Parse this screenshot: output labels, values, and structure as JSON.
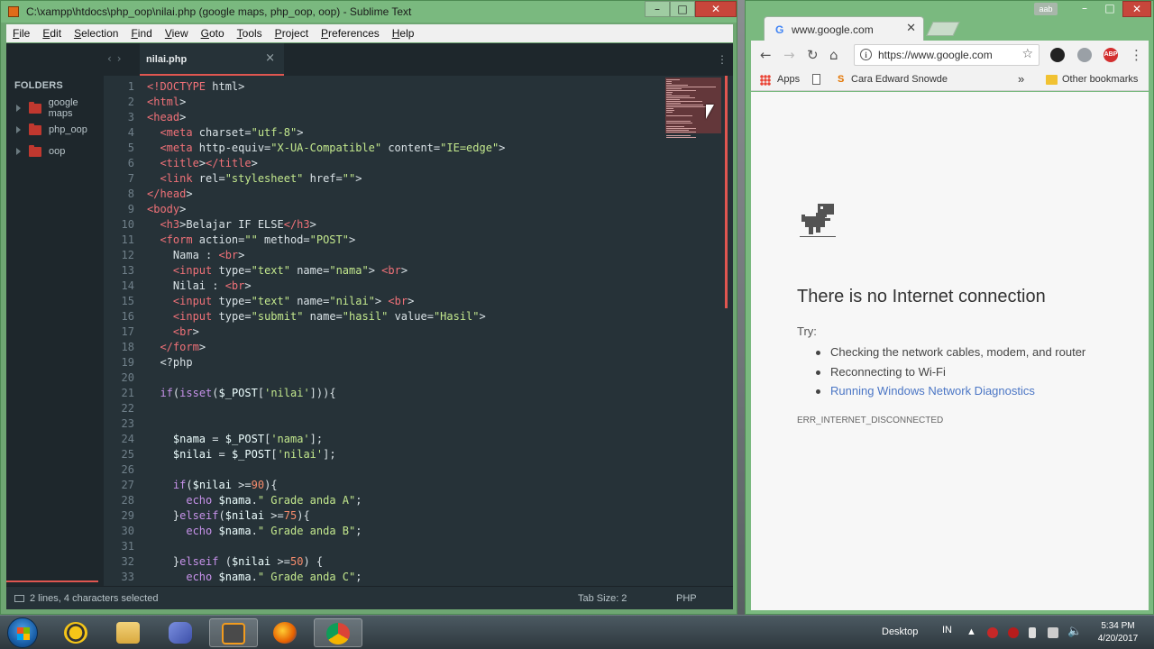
{
  "sublime": {
    "title": "C:\\xampp\\htdocs\\php_oop\\nilai.php (google maps, php_oop, oop) - Sublime Text",
    "menu": [
      "File",
      "Edit",
      "Selection",
      "Find",
      "View",
      "Goto",
      "Tools",
      "Project",
      "Preferences",
      "Help"
    ],
    "sidebar": {
      "header": "FOLDERS",
      "folders": [
        "google maps",
        "php_oop",
        "oop"
      ]
    },
    "tab": {
      "label": "nilai.php",
      "close": "×"
    },
    "status": {
      "selection": "2 lines, 4 characters selected",
      "tab_size": "Tab Size: 2",
      "syntax": "PHP"
    },
    "line_numbers": [
      "1",
      "2",
      "3",
      "4",
      "5",
      "6",
      "7",
      "8",
      "9",
      "10",
      "11",
      "12",
      "13",
      "14",
      "15",
      "16",
      "17",
      "18",
      "19",
      "20",
      "21",
      "22",
      "23",
      "24",
      "25",
      "26",
      "27",
      "28",
      "29",
      "30",
      "31",
      "32",
      "33",
      "34"
    ],
    "code_lines": [
      "<!DOCTYPE html>",
      "<html>",
      "<head>",
      "  <meta charset=\"utf-8\">",
      "  <meta http-equiv=\"X-UA-Compatible\" content=\"IE=edge\">",
      "  <title></title>",
      "  <link rel=\"stylesheet\" href=\"\">",
      "</head>",
      "<body>",
      "  <h3>Belajar IF ELSE</h3>",
      "  <form action=\"\" method=\"POST\">",
      "    Nama : <br>",
      "    <input type=\"text\" name=\"nama\"> <br>",
      "    Nilai : <br>",
      "    <input type=\"text\" name=\"nilai\"> <br>",
      "    <input type=\"submit\" name=\"hasil\" value=\"Hasil\">",
      "    <br>",
      "  </form>",
      "  <?php",
      "",
      "  if(isset($_POST['nilai'])){",
      "",
      "",
      "    $nama = $_POST['nama'];",
      "    $nilai = $_POST['nilai'];",
      "",
      "    if($nilai >=90){",
      "      echo $nama.\" Grade anda A\";",
      "    }elseif($nilai >=75){",
      "      echo $nama.\" Grade anda B\";",
      "",
      "    }elseif ($nilai >=50) {",
      "      echo $nama.\" Grade anda C\";",
      ""
    ]
  },
  "chrome": {
    "tab_title": "www.google.com",
    "user_badge": "aab",
    "url": "https://www.google.com",
    "bookmarks": {
      "apps": "Apps",
      "item": "Cara Edward Snowde",
      "overflow": "»",
      "other": "Other bookmarks"
    },
    "error": {
      "heading": "There is no Internet connection",
      "try": "Try:",
      "suggestions": [
        "Checking the network cables, modem, and router",
        "Reconnecting to Wi-Fi",
        "Running Windows Network Diagnostics"
      ],
      "code": "ERR_INTERNET_DISCONNECTED"
    }
  },
  "taskbar": {
    "desktop_label": "Desktop",
    "lang": "IN",
    "time": "5:34 PM",
    "date": "4/20/2017"
  },
  "colors": {
    "accent_red": "#e05650",
    "editor_bg": "#263238",
    "link_blue": "#4b76c5"
  }
}
